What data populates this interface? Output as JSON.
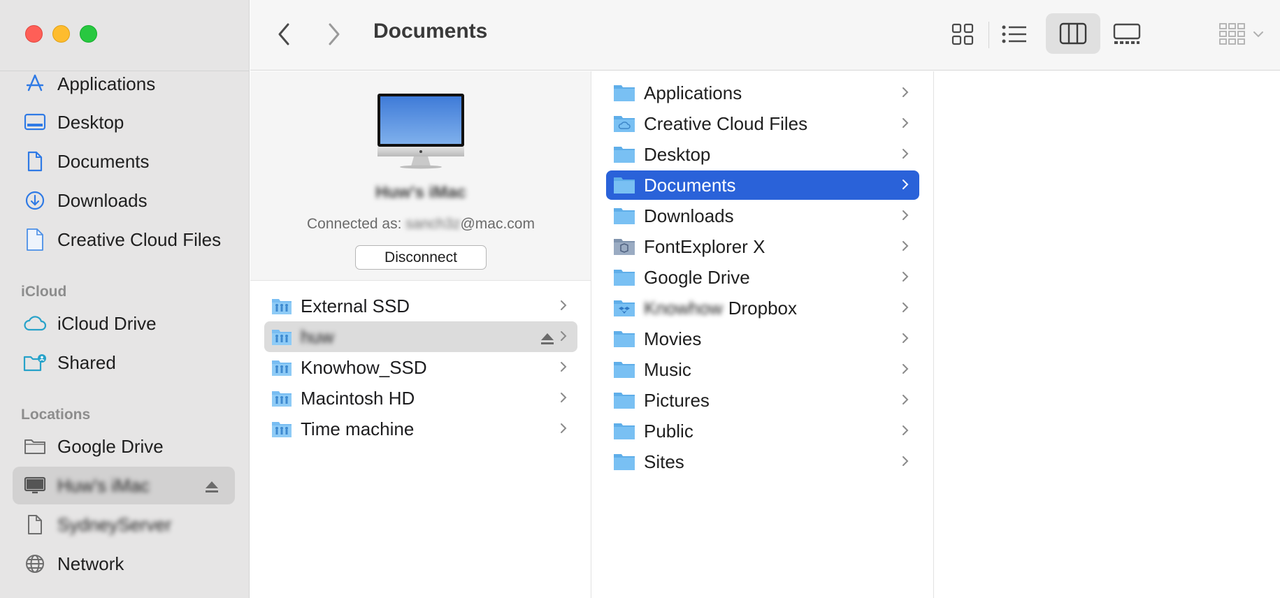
{
  "window": {
    "title": "Documents"
  },
  "sidebar": {
    "favorites": [
      {
        "label": "Applications",
        "icon": "applications-icon"
      },
      {
        "label": "Desktop",
        "icon": "desktop-icon"
      },
      {
        "label": "Documents",
        "icon": "document-icon"
      },
      {
        "label": "Downloads",
        "icon": "downloads-icon"
      },
      {
        "label": "Creative Cloud Files",
        "icon": "file-icon"
      }
    ],
    "icloud_header": "iCloud",
    "icloud": [
      {
        "label": "iCloud Drive",
        "icon": "cloud-icon"
      },
      {
        "label": "Shared",
        "icon": "shared-folder-icon"
      }
    ],
    "locations_header": "Locations",
    "locations": [
      {
        "label": "Google Drive",
        "icon": "folder-icon"
      },
      {
        "label": "Huw's iMac",
        "icon": "computer-icon",
        "selected": true,
        "blurred": true
      },
      {
        "label": "SydneyServer",
        "icon": "file-icon",
        "blurred": true
      },
      {
        "label": "Network",
        "icon": "globe-icon"
      }
    ]
  },
  "toolbar": {
    "back": "back",
    "forward": "forward",
    "views": [
      "icon-view",
      "list-view",
      "column-view",
      "gallery-view"
    ],
    "selected_view": "column-view",
    "group_menu": "group"
  },
  "computer": {
    "name": "Huw's iMac",
    "connected_prefix": "Connected as: ",
    "connected_user": "sanch3z",
    "connected_suffix": "@mac.com",
    "disconnect_label": "Disconnect"
  },
  "volumes": [
    {
      "label": "External SSD"
    },
    {
      "label": "huw",
      "selected": true,
      "blurred": true,
      "eject": true
    },
    {
      "label": "Knowhow_SSD"
    },
    {
      "label": "Macintosh HD"
    },
    {
      "label": "Time machine"
    }
  ],
  "folders": [
    {
      "label": "Applications",
      "type": "folder"
    },
    {
      "label": "Creative Cloud Files",
      "type": "cloud-folder"
    },
    {
      "label": "Desktop",
      "type": "folder"
    },
    {
      "label": "Documents",
      "type": "folder",
      "selected": true
    },
    {
      "label": "Downloads",
      "type": "folder"
    },
    {
      "label": "FontExplorer X",
      "type": "app-folder"
    },
    {
      "label": "Google Drive",
      "type": "folder"
    },
    {
      "label_blurred": "Knowhow",
      "label": "Dropbox",
      "type": "dropbox-folder"
    },
    {
      "label": "Movies",
      "type": "folder"
    },
    {
      "label": "Music",
      "type": "folder"
    },
    {
      "label": "Pictures",
      "type": "folder"
    },
    {
      "label": "Public",
      "type": "folder"
    },
    {
      "label": "Sites",
      "type": "folder"
    }
  ],
  "colors": {
    "accent": "#2a62d9",
    "sidebar_icon": "#2f7ae5",
    "folder": "#6fb6f0"
  }
}
